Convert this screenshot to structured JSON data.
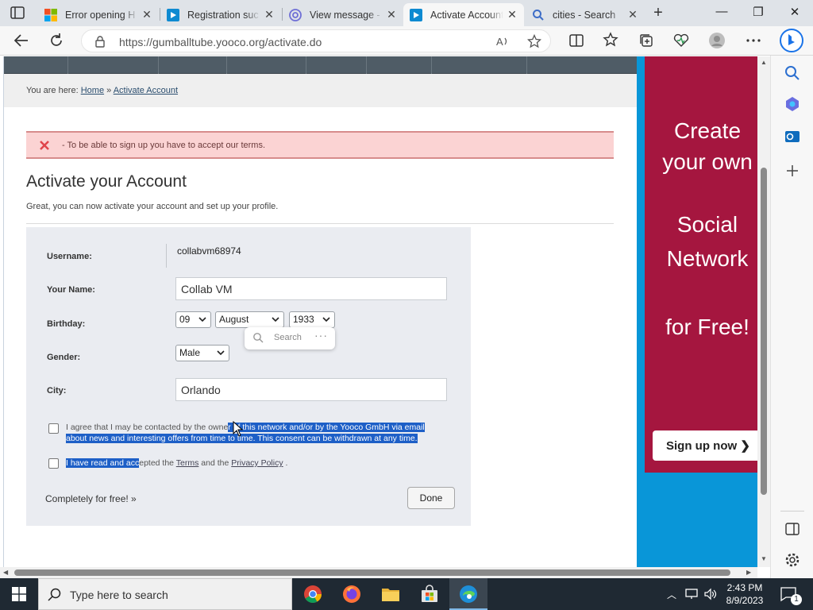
{
  "browser": {
    "tabs": [
      {
        "label": "Error opening H",
        "active": false
      },
      {
        "label": "Registration suc",
        "active": false
      },
      {
        "label": "View message -",
        "active": false
      },
      {
        "label": "Activate Account",
        "active": true
      },
      {
        "label": "cities - Search",
        "active": false
      }
    ],
    "url": "https://gumballtube.yooco.org/activate.do"
  },
  "page": {
    "breadcrumb": {
      "prefix": "You are here:",
      "home": "Home",
      "separator": "»",
      "current": "Activate Account"
    },
    "alert": "- To be able to sign up you have to accept our terms.",
    "title": "Activate your Account",
    "subtitle": "Great, you can now activate your account and set up your profile.",
    "form": {
      "username_label": "Username:",
      "username_value": "collabvm68974",
      "name_label": "Your Name:",
      "name_value": "Collab VM",
      "birthday_label": "Birthday:",
      "birthday_day": "09",
      "birthday_month": "August",
      "birthday_year": "1933",
      "gender_label": "Gender:",
      "gender_value": "Male",
      "city_label": "City:",
      "city_value": "Orlando",
      "consent_a": "I agree that I may be contacted by the owne",
      "consent_b": "r of this network and/or by the Yooco GmbH via email",
      "consent_c": "about news and interesting offers from time to time. This consent can be withdrawn at any time.",
      "terms_a": "I have read and acc",
      "terms_b": "epted the ",
      "terms_link": "Terms",
      "terms_and": " and the ",
      "privacy_link": "Privacy Policy",
      "terms_end": " .",
      "free_text": "Completely for free! »",
      "done_label": "Done"
    },
    "mini_search": {
      "placeholder": "Search",
      "more": "···"
    },
    "ad": {
      "line1": "Create",
      "line2": "your own",
      "line3": "Social",
      "line4": "Network",
      "line5": "for Free!",
      "button": "Sign up now ❯"
    }
  },
  "taskbar": {
    "search_placeholder": "Type here to search",
    "time": "2:43 PM",
    "date": "8/9/2023",
    "notification_count": "1"
  },
  "colors": {
    "accent": "#0078d4",
    "ad_bg": "#a5163f",
    "ad_side": "#0996d8",
    "alert_bg": "#fbd3d3",
    "selection": "#1d5fc7"
  }
}
